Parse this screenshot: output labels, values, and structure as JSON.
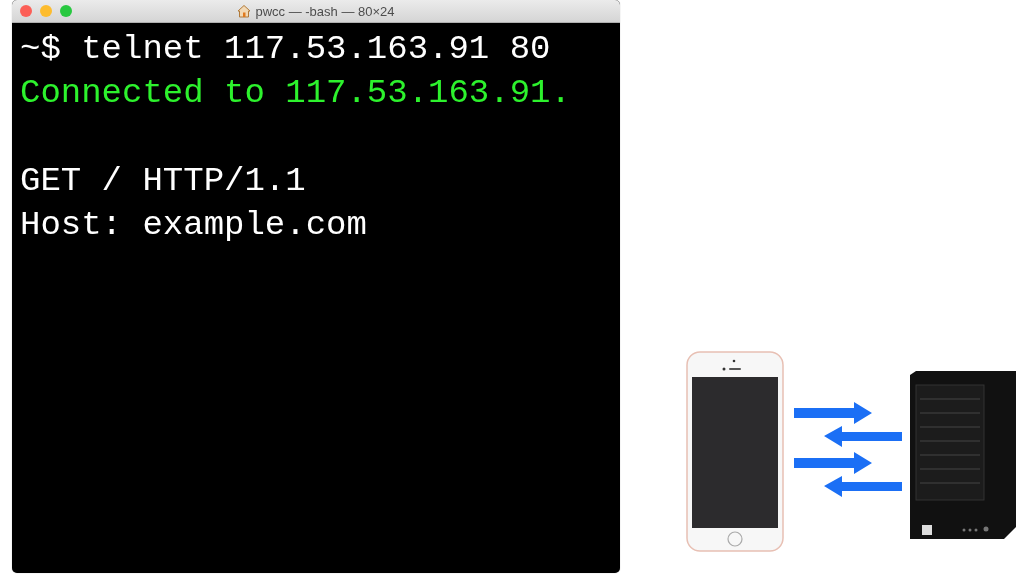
{
  "window": {
    "title": "pwcc — -bash — 80×24"
  },
  "terminal": {
    "blocks": [
      {
        "lines": [
          {
            "kind": "input",
            "text": "~$ telnet 117.53.163.91 80"
          },
          {
            "kind": "response",
            "text": "Connected to 117.53.163.91."
          }
        ]
      },
      {
        "lines": [
          {
            "kind": "input",
            "text": "GET / HTTP/1.1"
          },
          {
            "kind": "input",
            "text": "Host: example.com"
          }
        ]
      }
    ]
  }
}
